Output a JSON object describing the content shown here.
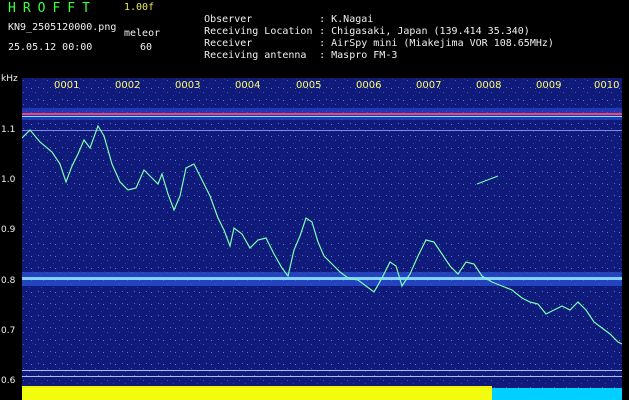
{
  "header": {
    "app_title": "HROFFT",
    "version": "1.00f",
    "filename": "KN9_2505120000.png",
    "unit_label": "meleor",
    "datetime": "25.05.12 00:00",
    "unit_value": "60"
  },
  "info": [
    {
      "label": "Observer",
      "value": "K.Nagai"
    },
    {
      "label": "Receiving Location",
      "value": "Chigasaki, Japan (139.414 35.340)"
    },
    {
      "label": "Receiver",
      "value": "AirSpy mini (Miakejima VOR 108.65MHz)"
    },
    {
      "label": "Receiving antenna",
      "value": "Maspro FM-3"
    }
  ],
  "axis": {
    "y_unit": "kHz",
    "y_ticks": [
      "1.1",
      "1.0",
      "0.9",
      "0.8",
      "0.7",
      "0.6"
    ],
    "x_ticks": [
      "0001",
      "0002",
      "0003",
      "0004",
      "0005",
      "0006",
      "0007",
      "0008",
      "0009",
      "0010"
    ]
  },
  "colors": {
    "title_green": "#3cff3c",
    "version_yellow": "#e8e860",
    "tick_yellow": "#ffff66",
    "background_blue": "#101a78",
    "trace_green": "#7dffb0",
    "band_cyan": "#8ad8ff",
    "carrier_red": "#ff4060",
    "bottom_yellow": "#ffff00",
    "bottom_cyan": "#00d0ff"
  }
}
